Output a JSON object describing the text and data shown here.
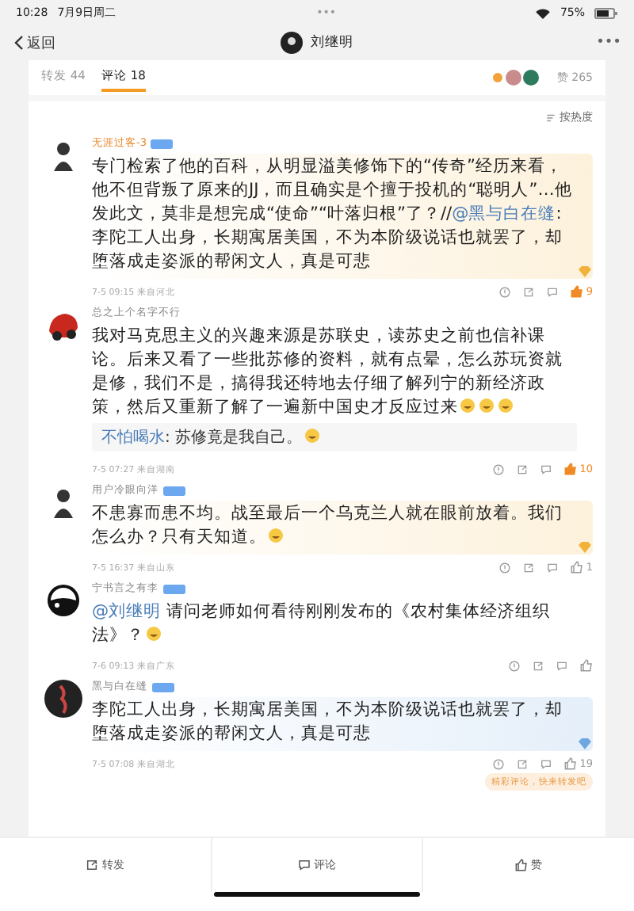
{
  "status_bar": {
    "time": "10:28",
    "date": "7月9日周二",
    "dots": "•••",
    "battery": "75%"
  },
  "nav": {
    "back": "返回",
    "title": "刘继明",
    "more": "•••"
  },
  "tabs": [
    {
      "label": "转发",
      "count": "44",
      "selected": false
    },
    {
      "label": "评论",
      "count": "18",
      "selected": true
    }
  ],
  "likes_summary": {
    "label": "赞",
    "count": "265"
  },
  "sort": {
    "label": "按热度"
  },
  "comments": [
    {
      "user": "无涯过客-3",
      "badge": true,
      "highlighted": true,
      "color": "#f2b23a",
      "parts": [
        {
          "kind": "text",
          "text": "专门检索了他的百科，从明显溢美修饰下的“传奇”经历来看，他不但背叛了原来的JJ，而且确实是个擅于投机的“聪明人”…他发此文，莫非是想完成“使命”“叶落归根”了？//"
        },
        {
          "kind": "mention",
          "text": "@黑与白在缝"
        },
        {
          "kind": "text",
          "text": ":李陀工人出身，长期寓居美国，不为本阶级说话也就罢了，却堕落成走姿派的帮闲文人，真是可悲"
        }
      ],
      "meta": "7-5 09:15 来自河北",
      "likes": "9",
      "liked": true
    },
    {
      "user": "总之上个名字不行",
      "badge": false,
      "highlighted": false,
      "parts": [
        {
          "kind": "text",
          "text": "我对马克思主义的兴趣来源是苏联史，读苏史之前也信补课论。后来又看了一些批苏修的资料，就有点晕，怎么苏玩资就是修，我们不是，搞得我还特地去仔细了解列宁的新经济政策，然后又重新了解了一遍新中国史才反应过来"
        },
        {
          "kind": "emoji"
        },
        {
          "kind": "emoji"
        },
        {
          "kind": "emoji"
        }
      ],
      "reply": {
        "user": "不怕喝水",
        "text": ": 苏修竟是我自己。"
      },
      "meta": "7-5 07:27 来自湖南",
      "likes": "10",
      "liked": true
    },
    {
      "user": "用户冷眼向洋",
      "badge": true,
      "highlighted": true,
      "color": "#f2b23a",
      "parts": [
        {
          "kind": "text",
          "text": "不患寡而患不均。战至最后一个乌克兰人就在眼前放着。我们怎么办？只有天知道。"
        },
        {
          "kind": "emoji"
        }
      ],
      "meta": "7-5 16:37 来自山东",
      "likes": "1",
      "liked": false
    },
    {
      "user": "宁书言之有李",
      "badge": true,
      "highlighted": false,
      "parts": [
        {
          "kind": "mention",
          "text": "@刘继明"
        },
        {
          "kind": "text",
          "text": " 请问老师如何看待刚刚发布的《农村集体经济组织法》？"
        },
        {
          "kind": "emoji"
        }
      ],
      "meta": "7-6 09:13 来自广东",
      "liked": false
    },
    {
      "user": "黑与白在缝",
      "badge": true,
      "highlighted": true,
      "color": "#6fa6e0",
      "parts": [
        {
          "kind": "text",
          "text": "李陀工人出身，长期寓居美国，不为本阶级说话也就罢了，却堕落成走姿派的帮闲文人，真是可悲"
        }
      ],
      "meta": "7-5 07:08 来自湖北",
      "likes": "19",
      "liked": false,
      "tag": "精彩评论，快来转发吧"
    }
  ],
  "bottom_bar": [
    {
      "kind": "repost",
      "label": "转发"
    },
    {
      "kind": "comment",
      "label": "评论"
    },
    {
      "kind": "like",
      "label": "赞"
    }
  ]
}
